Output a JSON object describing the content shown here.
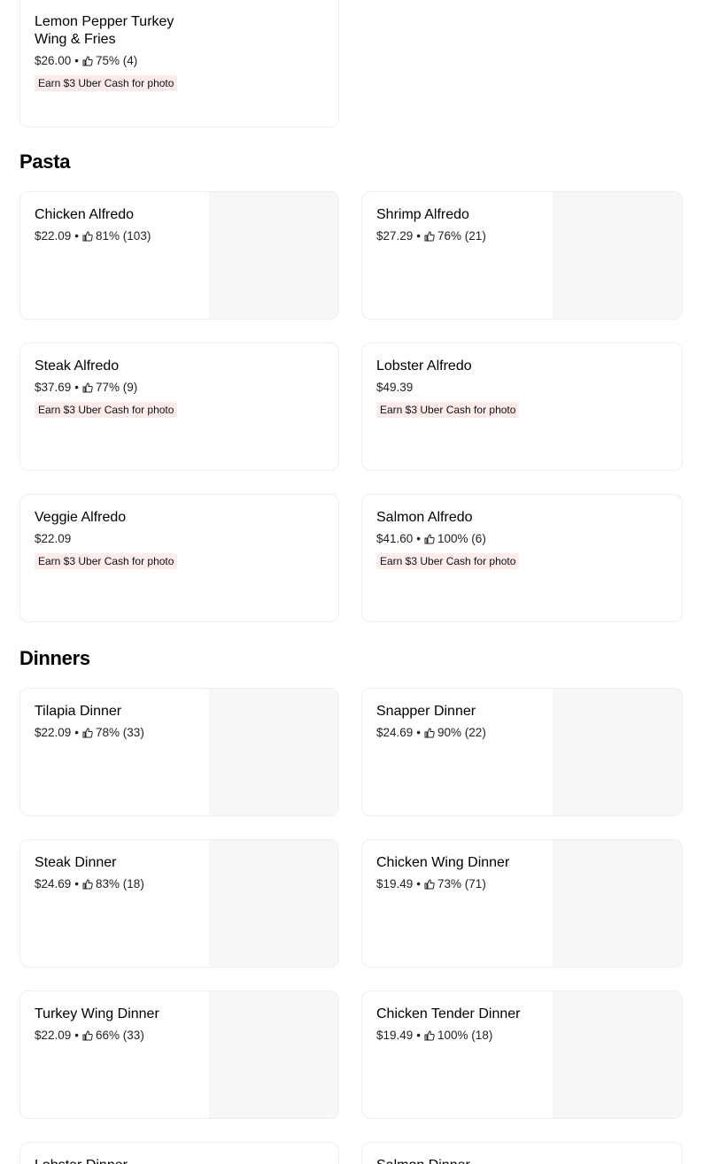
{
  "top_item": {
    "name": "Lemon Pepper Turkey Wing & Fries",
    "price": "$26.00",
    "separator": "•",
    "rating": "75% (4)",
    "promo": "Earn $3 Uber Cash for photo"
  },
  "sections": [
    {
      "title": "Pasta",
      "items": [
        {
          "name": "Chicken Alfredo",
          "price": "$22.09",
          "separator": "•",
          "rating": "81% (103)"
        },
        {
          "name": "Shrimp Alfredo",
          "price": "$27.29",
          "separator": "•",
          "rating": "76% (21)"
        },
        {
          "name": "Steak Alfredo",
          "price": "$37.69",
          "separator": "•",
          "rating": "77% (9)",
          "promo": "Earn $3 Uber Cash for photo"
        },
        {
          "name": "Lobster Alfredo",
          "price": "$49.39",
          "promo": "Earn $3 Uber Cash for photo"
        },
        {
          "name": "Veggie Alfredo",
          "price": "$22.09",
          "promo": "Earn $3 Uber Cash for photo"
        },
        {
          "name": "Salmon Alfredo",
          "price": "$41.60",
          "separator": "•",
          "rating": "100% (6)",
          "promo": "Earn $3 Uber Cash for photo"
        }
      ]
    },
    {
      "title": "Dinners",
      "items": [
        {
          "name": "Tilapia Dinner",
          "price": "$22.09",
          "separator": "•",
          "rating": "78% (33)"
        },
        {
          "name": "Snapper Dinner",
          "price": "$24.69",
          "separator": "•",
          "rating": "90% (22)"
        },
        {
          "name": "Steak Dinner",
          "price": "$24.69",
          "separator": "•",
          "rating": "83% (18)"
        },
        {
          "name": "Chicken Wing Dinner",
          "price": "$19.49",
          "separator": "•",
          "rating": "73% (71)"
        },
        {
          "name": "Turkey Wing Dinner",
          "price": "$22.09",
          "separator": "•",
          "rating": "66% (33)"
        },
        {
          "name": "Chicken Tender Dinner",
          "price": "$19.49",
          "separator": "•",
          "rating": "100% (18)"
        },
        {
          "name": "Lobster Dinner"
        },
        {
          "name": "Salmon Dinner"
        }
      ]
    }
  ],
  "icons": {
    "rating": "thumbs-up-icon"
  },
  "colors": {
    "promo_bg": "#fdecea",
    "image_placeholder": "#f7f7f7",
    "card_border": "#eeeeee"
  }
}
